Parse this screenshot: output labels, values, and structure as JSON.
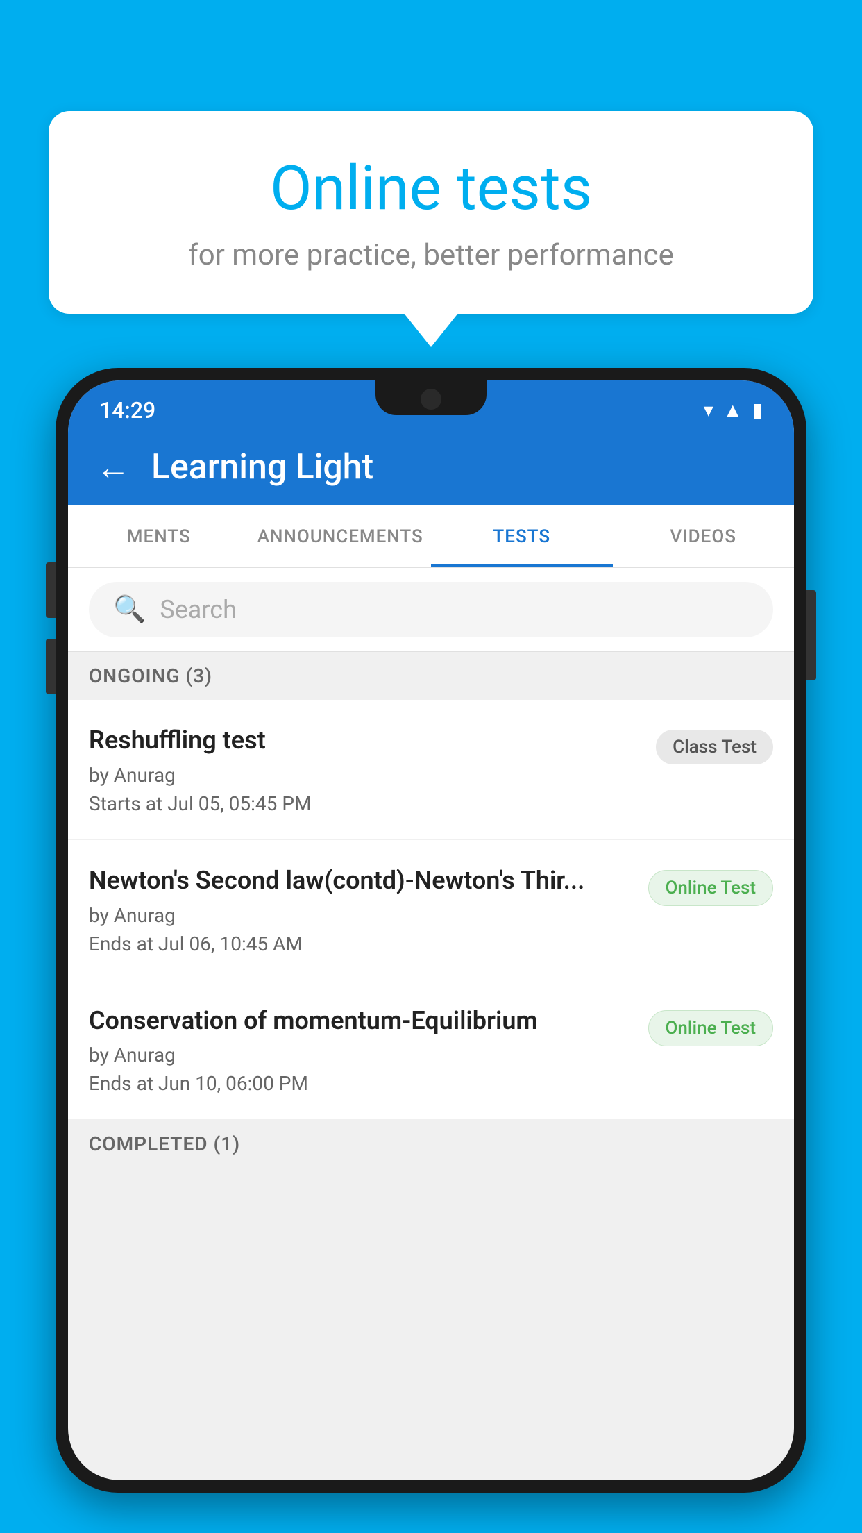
{
  "bubble": {
    "title": "Online tests",
    "subtitle": "for more practice, better performance"
  },
  "statusBar": {
    "time": "14:29",
    "icons": [
      "wifi",
      "signal",
      "battery"
    ]
  },
  "appBar": {
    "title": "Learning Light",
    "backLabel": "←"
  },
  "tabs": [
    {
      "label": "MENTS",
      "active": false
    },
    {
      "label": "ANNOUNCEMENTS",
      "active": false
    },
    {
      "label": "TESTS",
      "active": true
    },
    {
      "label": "VIDEOS",
      "active": false
    }
  ],
  "search": {
    "placeholder": "Search"
  },
  "ongoingSection": {
    "label": "ONGOING (3)"
  },
  "tests": [
    {
      "name": "Reshuffling test",
      "author": "by Anurag",
      "time": "Starts at  Jul 05, 05:45 PM",
      "badge": "Class Test",
      "badgeType": "class"
    },
    {
      "name": "Newton's Second law(contd)-Newton's Thir...",
      "author": "by Anurag",
      "time": "Ends at  Jul 06, 10:45 AM",
      "badge": "Online Test",
      "badgeType": "online"
    },
    {
      "name": "Conservation of momentum-Equilibrium",
      "author": "by Anurag",
      "time": "Ends at  Jun 10, 06:00 PM",
      "badge": "Online Test",
      "badgeType": "online"
    }
  ],
  "completedSection": {
    "label": "COMPLETED (1)"
  },
  "colors": {
    "background": "#00AEEF",
    "appBar": "#1976D2",
    "activeTab": "#1976D2"
  }
}
